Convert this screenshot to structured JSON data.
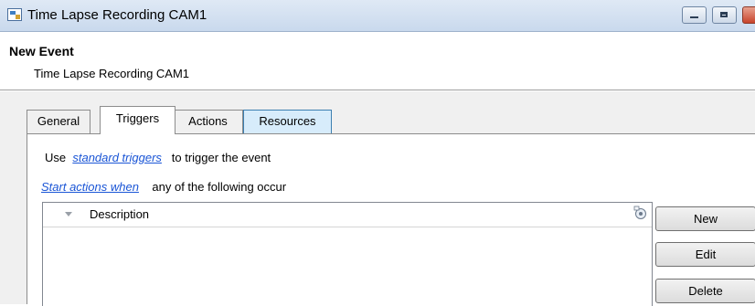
{
  "window": {
    "title": "Time Lapse Recording CAM1"
  },
  "header": {
    "title": "New Event",
    "subtitle": "Time Lapse Recording CAM1"
  },
  "tabs": [
    {
      "label": "General",
      "selected": false
    },
    {
      "label": "Triggers",
      "selected": true
    },
    {
      "label": "Actions",
      "selected": false
    },
    {
      "label": "Resources",
      "selected": false,
      "highlighted": true
    }
  ],
  "triggers": {
    "line1_prefix": "Use",
    "line1_link": "standard triggers",
    "line1_suffix": "to trigger the event",
    "line2_link": "Start actions when",
    "line2_suffix": "any of the following occur"
  },
  "list": {
    "column_header": "Description",
    "rows": []
  },
  "buttons": {
    "new": "New",
    "edit": "Edit",
    "delete": "Delete"
  },
  "colors": {
    "link": "#1a55d6",
    "highlight_tab": "#d7ecfb",
    "close_button": "#c8442b"
  }
}
